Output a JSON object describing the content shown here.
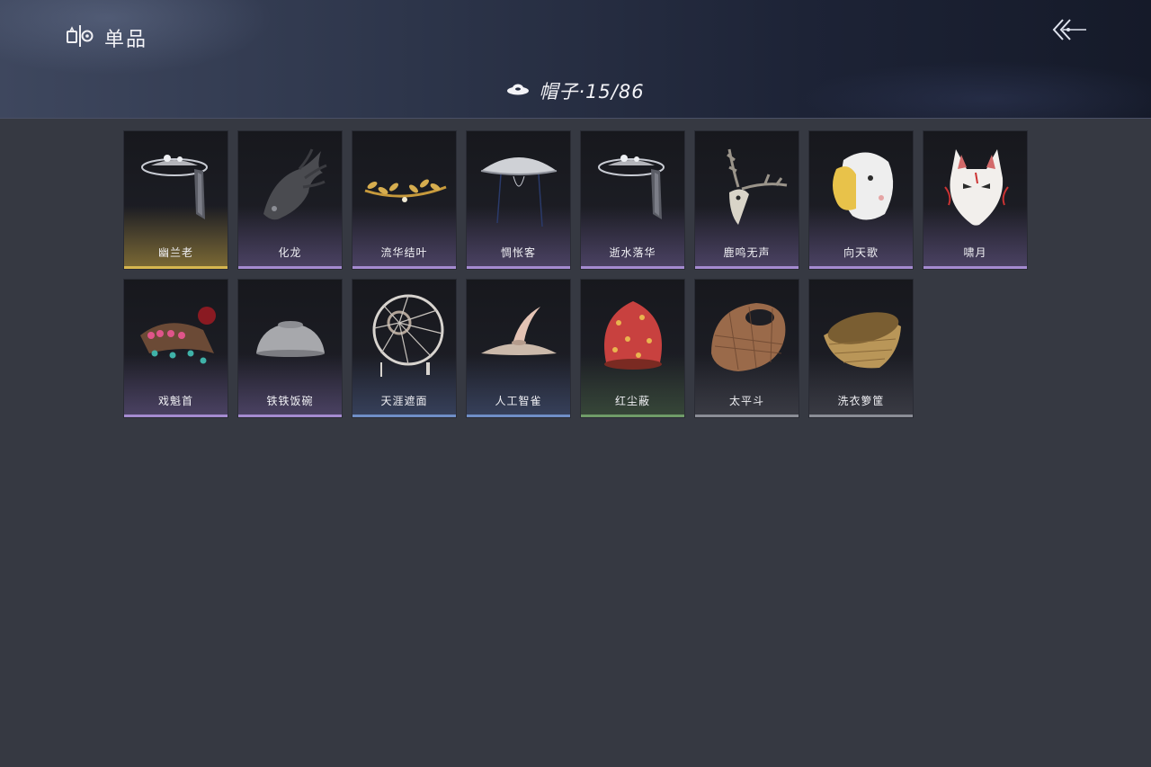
{
  "header": {
    "section_title": "单品",
    "section_icon": "wardrobe-icon",
    "back_icon": "back-arrow-icon"
  },
  "category": {
    "icon": "hat-icon",
    "label": "帽子·15/86"
  },
  "items": [
    {
      "name": "幽兰老",
      "rarity": "gold",
      "icon": "veiled-wide-hat"
    },
    {
      "name": "化龙",
      "rarity": "purple",
      "icon": "dragon-headpiece"
    },
    {
      "name": "流华结叶",
      "rarity": "purple",
      "icon": "golden-leaf-circlet"
    },
    {
      "name": "惆怅客",
      "rarity": "purple",
      "icon": "straw-bamboo-hat"
    },
    {
      "name": "逝水落华",
      "rarity": "purple",
      "icon": "veiled-wide-hat"
    },
    {
      "name": "鹿鸣无声",
      "rarity": "purple",
      "icon": "deer-skull-antlers"
    },
    {
      "name": "向天歌",
      "rarity": "purple",
      "icon": "goose-hood"
    },
    {
      "name": "啸月",
      "rarity": "purple",
      "icon": "fox-mask"
    },
    {
      "name": "戏魁首",
      "rarity": "purple",
      "icon": "opera-headdress"
    },
    {
      "name": "铁铁饭碗",
      "rarity": "purple",
      "icon": "iron-bowl"
    },
    {
      "name": "天涯遮面",
      "rarity": "blue",
      "icon": "woven-ring-hat"
    },
    {
      "name": "人工智雀",
      "rarity": "blue",
      "icon": "bird-hat"
    },
    {
      "name": "红尘蔽",
      "rarity": "green",
      "icon": "red-cloth-hood"
    },
    {
      "name": "太平斗",
      "rarity": "grey",
      "icon": "wicker-basket-hat"
    },
    {
      "name": "洗衣箩筐",
      "rarity": "grey",
      "icon": "laundry-basket"
    }
  ]
}
